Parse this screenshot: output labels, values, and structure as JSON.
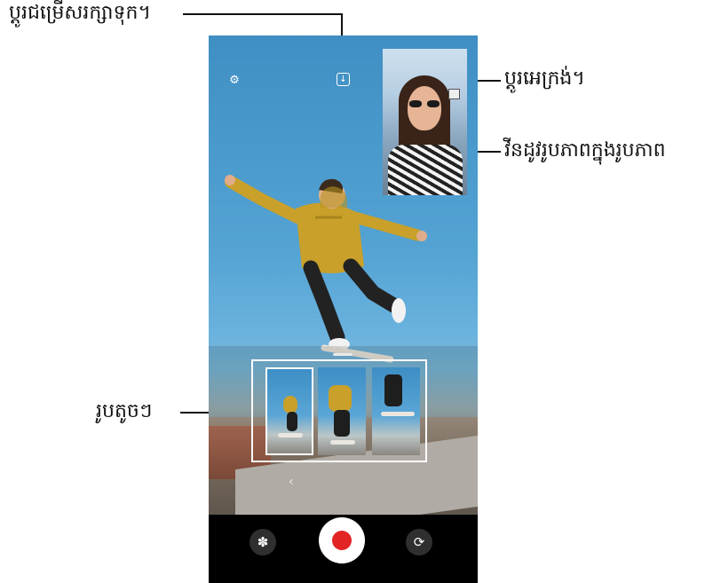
{
  "callouts": {
    "change_save_options": "ប្ដូរជម្រើសរក្សាទុក។",
    "change_background": "ប្ដូរអេក្រង់។",
    "pip_view": "វីនដូវរូបភាពក្នុងរូបភាព",
    "thumbnails": "រូបតូចៗ"
  },
  "icons": {
    "settings": "gear-icon",
    "save_options": "download-icon",
    "pip_change": "square-icon",
    "effects": "flower-icon",
    "record": "record-icon",
    "switch_camera": "rotate-camera-icon",
    "chevron": "chevron-left-icon"
  },
  "glyphs": {
    "gear": "⚙",
    "download": "↓",
    "chevron": "‹",
    "flower": "✽",
    "rotate": "⟳"
  },
  "colors": {
    "record": "#e32424",
    "shirt": "#c8a02a",
    "sky": "#4a9bd0"
  }
}
